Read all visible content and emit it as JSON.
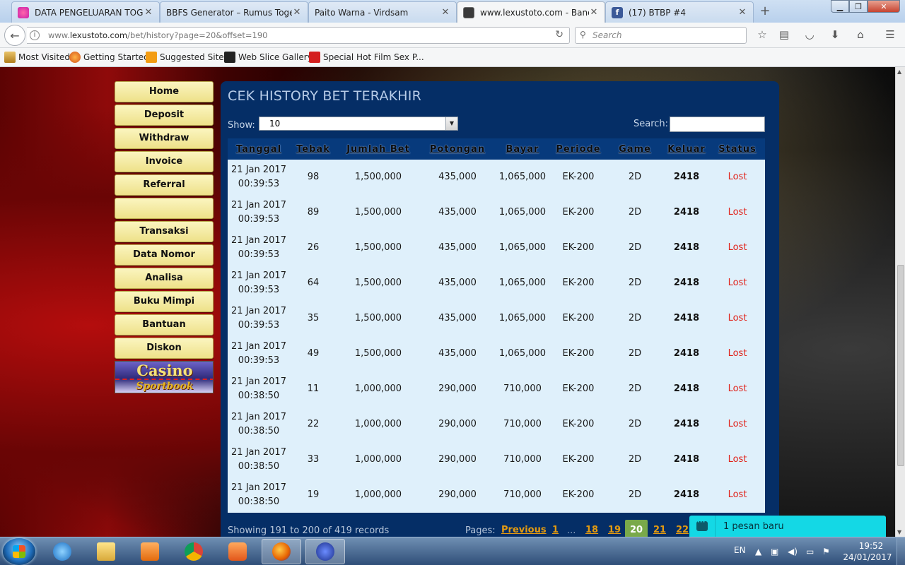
{
  "browser": {
    "tabs": [
      {
        "title": "DATA PENGELUARAN TOG...",
        "color": "#e040c0"
      },
      {
        "title": "BBFS Generator – Rumus Togel...",
        "color": ""
      },
      {
        "title": "Paito Warna - Virdsam",
        "color": ""
      },
      {
        "title": "www.lexustoto.com - Band...",
        "color": "#3a3a3a"
      },
      {
        "title": "(17) BTBP #4",
        "color": "#3b5998"
      }
    ],
    "url_prefix": "www.",
    "url_host": "lexustoto.com",
    "url_path": "/bet/history?page=20&offset=190",
    "search_placeholder": "Search",
    "bookmarks": [
      "Most Visited",
      "Getting Started",
      "Suggested Sites",
      "Web Slice Gallery",
      "Special Hot Film Sex P..."
    ]
  },
  "menu": {
    "items": [
      "Home",
      "Deposit",
      "Withdraw",
      "Invoice",
      "Referral",
      "",
      "Transaksi",
      "Data Nomor",
      "Analisa",
      "Buku Mimpi",
      "Bantuan",
      "Diskon"
    ],
    "banner_top": "Casino",
    "banner_bottom": "Sportbook"
  },
  "panel": {
    "title": "CEK HISTORY BET TERAKHIR",
    "show_label": "Show:",
    "show_value": "10",
    "search_label": "Search:",
    "search_value": ""
  },
  "table": {
    "headers": [
      "Tanggal",
      "Tebak",
      "Jumlah Bet",
      "Potongan",
      "Bayar",
      "Periode",
      "Game",
      "Keluar",
      "Status"
    ],
    "rows": [
      [
        "21 Jan 2017\n00:39:53",
        "98",
        "1,500,000",
        "435,000",
        "1,065,000",
        "EK-200",
        "2D",
        "2418",
        "Lost"
      ],
      [
        "21 Jan 2017\n00:39:53",
        "89",
        "1,500,000",
        "435,000",
        "1,065,000",
        "EK-200",
        "2D",
        "2418",
        "Lost"
      ],
      [
        "21 Jan 2017\n00:39:53",
        "26",
        "1,500,000",
        "435,000",
        "1,065,000",
        "EK-200",
        "2D",
        "2418",
        "Lost"
      ],
      [
        "21 Jan 2017\n00:39:53",
        "64",
        "1,500,000",
        "435,000",
        "1,065,000",
        "EK-200",
        "2D",
        "2418",
        "Lost"
      ],
      [
        "21 Jan 2017\n00:39:53",
        "35",
        "1,500,000",
        "435,000",
        "1,065,000",
        "EK-200",
        "2D",
        "2418",
        "Lost"
      ],
      [
        "21 Jan 2017\n00:39:53",
        "49",
        "1,500,000",
        "435,000",
        "1,065,000",
        "EK-200",
        "2D",
        "2418",
        "Lost"
      ],
      [
        "21 Jan 2017\n00:38:50",
        "11",
        "1,000,000",
        "290,000",
        "710,000",
        "EK-200",
        "2D",
        "2418",
        "Lost"
      ],
      [
        "21 Jan 2017\n00:38:50",
        "22",
        "1,000,000",
        "290,000",
        "710,000",
        "EK-200",
        "2D",
        "2418",
        "Lost"
      ],
      [
        "21 Jan 2017\n00:38:50",
        "33",
        "1,000,000",
        "290,000",
        "710,000",
        "EK-200",
        "2D",
        "2418",
        "Lost"
      ],
      [
        "21 Jan 2017\n00:38:50",
        "19",
        "1,000,000",
        "290,000",
        "710,000",
        "EK-200",
        "2D",
        "2418",
        "Lost"
      ]
    ],
    "status_color": "#e0231b"
  },
  "footer": {
    "info": "Showing 191 to 200 of 419 records",
    "pages_label": "Pages:",
    "previous": "Previous",
    "first": "1",
    "ellipsis": "...",
    "pages_before": [
      "18",
      "19"
    ],
    "current": "20",
    "pages_after": [
      "21",
      "22"
    ]
  },
  "chat": {
    "text": "1 pesan baru",
    "color": "#14d8e5"
  },
  "taskbar": {
    "lang": "EN",
    "time": "19:52",
    "date": "24/01/2017"
  }
}
